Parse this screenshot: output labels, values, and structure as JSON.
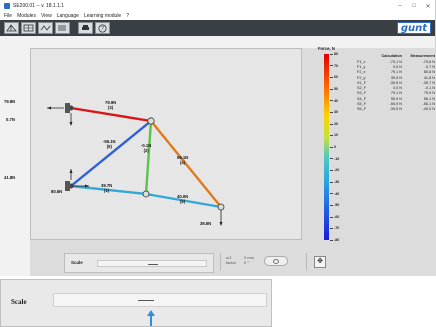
{
  "window": {
    "title": "SE200.01 -- v. 18.1.1.1",
    "controls": [
      "–",
      "□",
      "✕"
    ]
  },
  "menu": [
    "File",
    "Modules",
    "View",
    "Language",
    "Learning module",
    "?"
  ],
  "toolbar": {
    "buttons": [
      "truss-view-icon",
      "grid-view-icon",
      "model-icon",
      "columns-icon",
      "print-icon",
      "help-icon"
    ],
    "logo": "gunt"
  },
  "colors": {
    "red": "#d81818",
    "orange": "#e07a1a",
    "green": "#5cc24a",
    "blue": "#2f5fd8",
    "lightblue": "#33a8d6",
    "darkbg": "#3a3f44"
  },
  "truss": {
    "nodes": [
      "n1",
      "n2",
      "n3",
      "n4",
      "n5",
      "n6"
    ],
    "member_labels": [
      {
        "value": "79.9N",
        "id": "(3)"
      },
      {
        "value": "-56.1N",
        "id": "(5)"
      },
      {
        "value": "-0.1N",
        "id": "(2)"
      },
      {
        "value": "56.1N",
        "id": "(4)"
      },
      {
        "value": "39.7N",
        "id": "(1)"
      },
      {
        "value": "40.0N",
        "id": "(6)"
      }
    ],
    "support_labels": {
      "top_left_force": "79.8N",
      "top_left_moment": "0.7N",
      "bottom_left_force": "41.8N",
      "bottom_left_second": "80.6N",
      "bottom_right": "39.5N"
    }
  },
  "colorbar": {
    "title": "Force, N",
    "ticks": [
      "80",
      "70",
      "60",
      "50",
      "40",
      "30",
      "20",
      "10",
      "0",
      "-10",
      "-20",
      "-30",
      "-40",
      "-50",
      "-60",
      "-70",
      "-80"
    ]
  },
  "results_table": {
    "headers": [
      "",
      "Calculation",
      "Measurement"
    ],
    "rows": [
      [
        "F1_x",
        "-79,1 N",
        "-79,6 N"
      ],
      [
        "F1_y",
        "0,0 N",
        "-0,7 N"
      ],
      [
        "F2_x",
        "79,1 N",
        "80,6 N"
      ],
      [
        "F2_y",
        "39,5 N",
        "41,8 N"
      ],
      [
        "S1_F",
        "-39,5 N",
        "-39,7 N"
      ],
      [
        "S2_F",
        "0,0 N",
        "-0,1 N"
      ],
      [
        "S3_F",
        "79,1 N",
        "79,9 N"
      ],
      [
        "S4_F",
        "55,9 N",
        "56,1 N"
      ],
      [
        "S5_F",
        "-55,9 N",
        "-56,1 N"
      ],
      [
        "S6_F",
        "-39,5 N",
        "-40,0 N"
      ]
    ]
  },
  "bottom_bar": {
    "scale_label": "Scale",
    "uv_label": "u/1",
    "uv_value": "factor",
    "mm_label": "0 mm",
    "deg_label": "0 °"
  },
  "zoom_inset": {
    "scale_label": "Scale"
  }
}
